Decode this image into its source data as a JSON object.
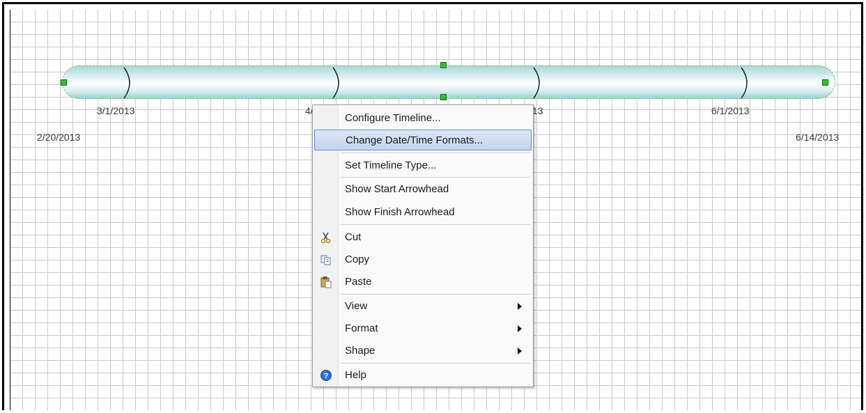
{
  "timeline": {
    "dates": {
      "start": "2/20/2013",
      "mar": "3/1/2013",
      "apr": "4/1/2013",
      "may": "5/1/2013",
      "jun": "6/1/2013",
      "end": "6/14/2013"
    }
  },
  "context_menu": {
    "items": [
      {
        "label": "Configure Timeline..."
      },
      {
        "label": "Change Date/Time Formats..."
      },
      {
        "label": "Set Timeline Type..."
      },
      {
        "label": "Show Start Arrowhead"
      },
      {
        "label": "Show Finish Arrowhead"
      },
      {
        "label": "Cut",
        "icon": "scissors-icon"
      },
      {
        "label": "Copy",
        "icon": "copy-icon"
      },
      {
        "label": "Paste",
        "icon": "paste-icon"
      },
      {
        "label": "View",
        "submenu": true
      },
      {
        "label": "Format",
        "submenu": true
      },
      {
        "label": "Shape",
        "submenu": true
      },
      {
        "label": "Help",
        "icon": "help-icon"
      }
    ],
    "highlighted_index": 1
  },
  "colors": {
    "highlight": "#c3d4ef",
    "handle": "#2dc22d",
    "bar": "#a9d7d8"
  }
}
